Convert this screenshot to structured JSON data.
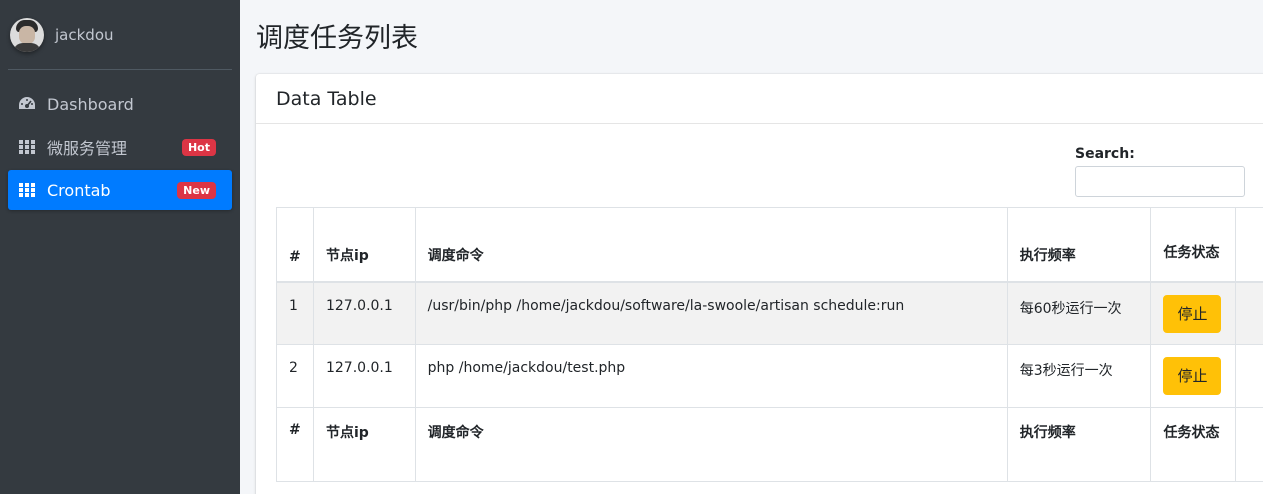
{
  "sidebar": {
    "user_name": "jackdou",
    "items": [
      {
        "label": "Dashboard",
        "icon": "dashboard-icon",
        "badge": ""
      },
      {
        "label": "微服务管理",
        "icon": "grid-icon",
        "badge": "Hot"
      },
      {
        "label": "Crontab",
        "icon": "grid-icon",
        "badge": "New",
        "active": true
      }
    ]
  },
  "page": {
    "title": "调度任务列表"
  },
  "card": {
    "title": "Data Table",
    "search_label": "Search:",
    "search_value": ""
  },
  "table": {
    "headers": [
      "#",
      "节点ip",
      "调度命令",
      "执行频率",
      "任务状态",
      ""
    ],
    "rows": [
      {
        "num": "1",
        "ip": "127.0.0.1",
        "command": "/usr/bin/php /home/jackdou/software/la-swoole/artisan schedule:run",
        "frequency": "每60秒运行一次",
        "action": "停止"
      },
      {
        "num": "2",
        "ip": "127.0.0.1",
        "command": "php /home/jackdou/test.php",
        "frequency": "每3秒运行一次",
        "action": "停止"
      }
    ]
  },
  "colors": {
    "sidebar_bg": "#343a40",
    "active_nav": "#007bff",
    "badge_bg": "#dc3545",
    "stop_button": "#ffc107"
  }
}
